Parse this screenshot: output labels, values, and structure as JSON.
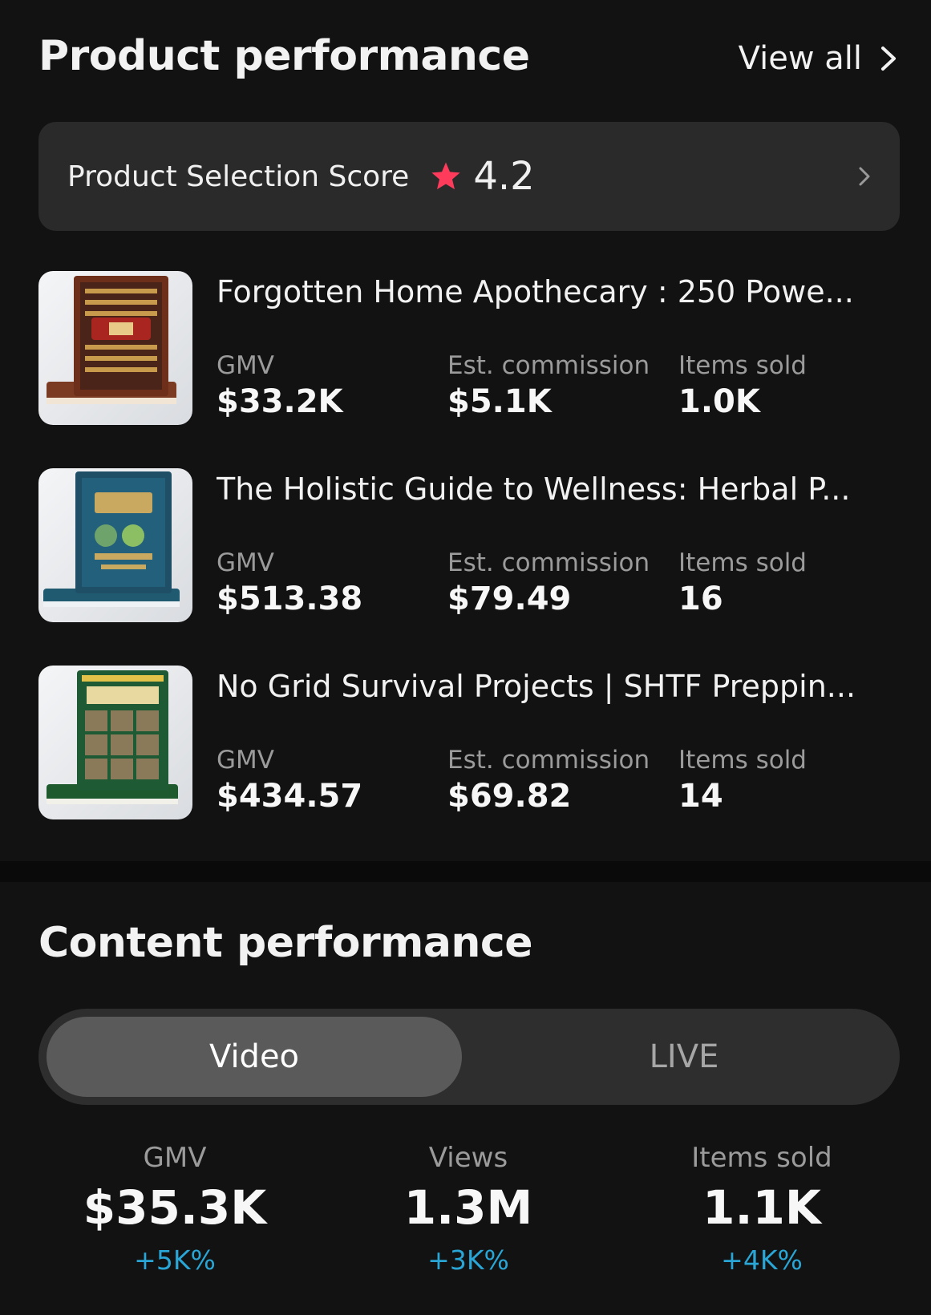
{
  "product_performance": {
    "title": "Product performance",
    "view_all": "View all",
    "score": {
      "label": "Product Selection Score",
      "value": "4.2",
      "star_color": "#ff3b5c"
    },
    "products": [
      {
        "name": "Forgotten Home Apothecary : 250 Powe...",
        "cover": "apothecary-book-icon",
        "gmv_label": "GMV",
        "gmv": "$33.2K",
        "commission_label": "Est. commission",
        "commission": "$5.1K",
        "sold_label": "Items sold",
        "sold": "1.0K"
      },
      {
        "name": "The Holistic Guide to Wellness: Herbal P...",
        "cover": "holistic-guide-book-icon",
        "gmv_label": "GMV",
        "gmv": "$513.38",
        "commission_label": "Est. commission",
        "commission": "$79.49",
        "sold_label": "Items sold",
        "sold": "16"
      },
      {
        "name": "No Grid Survival Projects | SHTF Preppin...",
        "cover": "no-grid-book-icon",
        "gmv_label": "GMV",
        "gmv": "$434.57",
        "commission_label": "Est. commission",
        "commission": "$69.82",
        "sold_label": "Items sold",
        "sold": "14"
      }
    ]
  },
  "content_performance": {
    "title": "Content performance",
    "tabs": [
      {
        "label": "Video",
        "active": true
      },
      {
        "label": "LIVE",
        "active": false
      }
    ],
    "stats": [
      {
        "label": "GMV",
        "value": "$35.3K",
        "change": "+5K%"
      },
      {
        "label": "Views",
        "value": "1.3M",
        "change": "+3K%"
      },
      {
        "label": "Items sold",
        "value": "1.1K",
        "change": "+4K%"
      }
    ],
    "change_color": "#2aa6d6"
  }
}
